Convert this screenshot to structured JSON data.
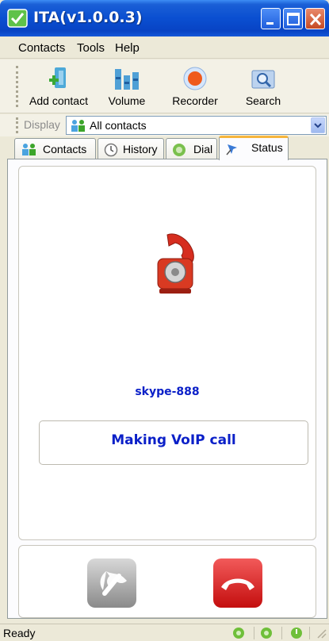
{
  "window": {
    "title": "ITA(v1.0.0.3)",
    "app_icon": "check-mark-icon"
  },
  "menu": {
    "items": [
      "Contacts",
      "Tools",
      "Help"
    ]
  },
  "toolbar": {
    "buttons": [
      {
        "label": "Add contact",
        "icon": "add-contact-icon"
      },
      {
        "label": "Volume",
        "icon": "volume-bars-icon"
      },
      {
        "label": "Recorder",
        "icon": "record-icon"
      },
      {
        "label": "Search",
        "icon": "magnifier-icon"
      }
    ]
  },
  "display": {
    "label": "Display",
    "selected": "All contacts"
  },
  "tabs": [
    {
      "label": "Contacts",
      "icon": "contacts-icon",
      "active": false
    },
    {
      "label": "History",
      "icon": "clock-icon",
      "active": false
    },
    {
      "label": "Dial",
      "icon": "dial-icon",
      "active": false
    },
    {
      "label": "Status",
      "icon": "pin-icon",
      "active": true
    }
  ],
  "status_panel": {
    "contact_name": "skype-888",
    "call_state": "Making VoIP call",
    "phone_icon": "rotary-phone-icon"
  },
  "call_buttons": {
    "answer": "answer-call-icon",
    "hangup": "hang-up-icon"
  },
  "statusbar": {
    "text": "Ready"
  },
  "colors": {
    "title_blue": "#0a4fd1",
    "accent_text": "#0b20c8",
    "hangup_red": "#d21a1a",
    "active_tab": "#f6b53d"
  }
}
